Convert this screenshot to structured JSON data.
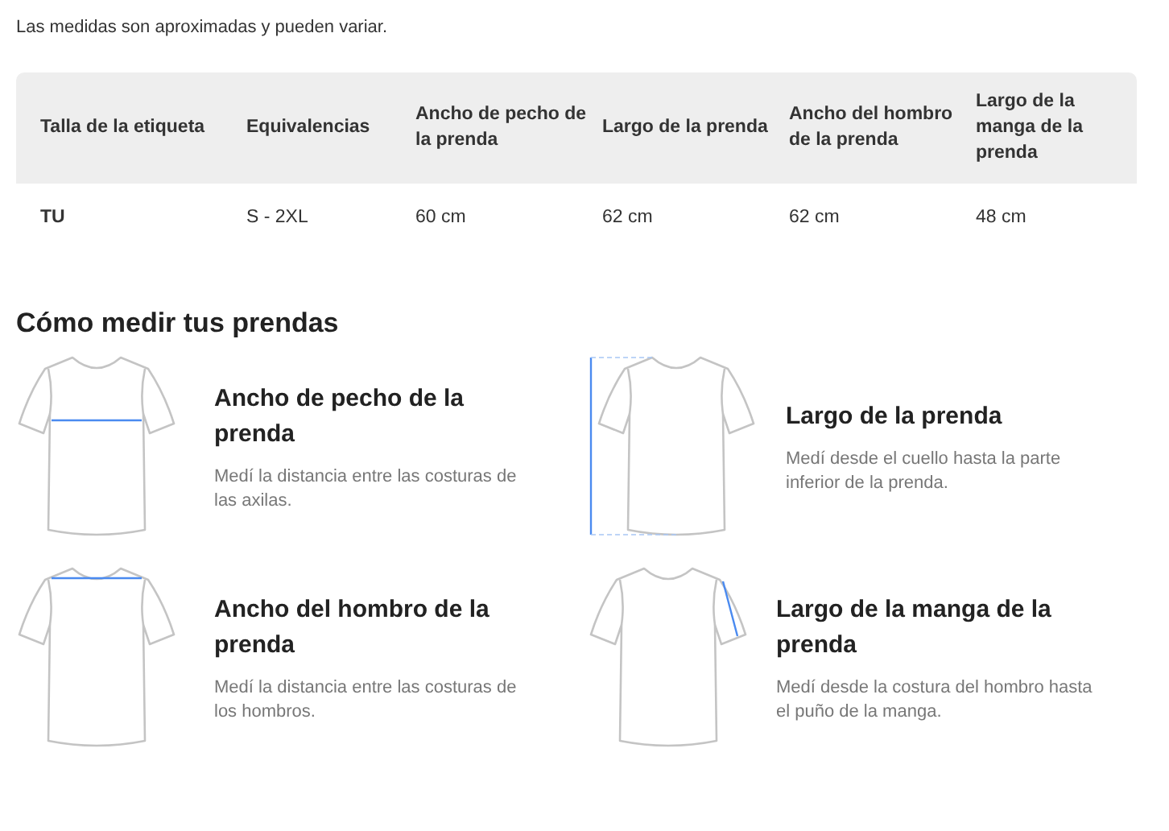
{
  "note": "Las medidas son aproximadas y pueden variar.",
  "table": {
    "columns": [
      "Talla de la etiqueta",
      "Equivalencias",
      "Ancho de pecho de la prenda",
      "Largo de la prenda",
      "Ancho del hombro de la prenda",
      "Largo de la manga de la prenda"
    ],
    "rows": [
      [
        "TU",
        "S - 2XL",
        "60 cm",
        "62 cm",
        "62 cm",
        "48 cm"
      ]
    ]
  },
  "guide": {
    "title": "Cómo medir tus prendas",
    "items": [
      {
        "kind": "chest",
        "title": "Ancho de pecho de la prenda",
        "description": "Medí la distancia entre las costuras de las axilas."
      },
      {
        "kind": "length",
        "title": "Largo de la prenda",
        "description": "Medí desde el cuello hasta la parte inferior de la prenda."
      },
      {
        "kind": "shoulder",
        "title": "Ancho del hombro de la prenda",
        "description": "Medí la distancia entre las costuras de los hombros."
      },
      {
        "kind": "sleeve",
        "title": "Largo de la manga de la prenda",
        "description": "Medí desde la costura del hombro hasta el puño de la manga."
      }
    ]
  }
}
